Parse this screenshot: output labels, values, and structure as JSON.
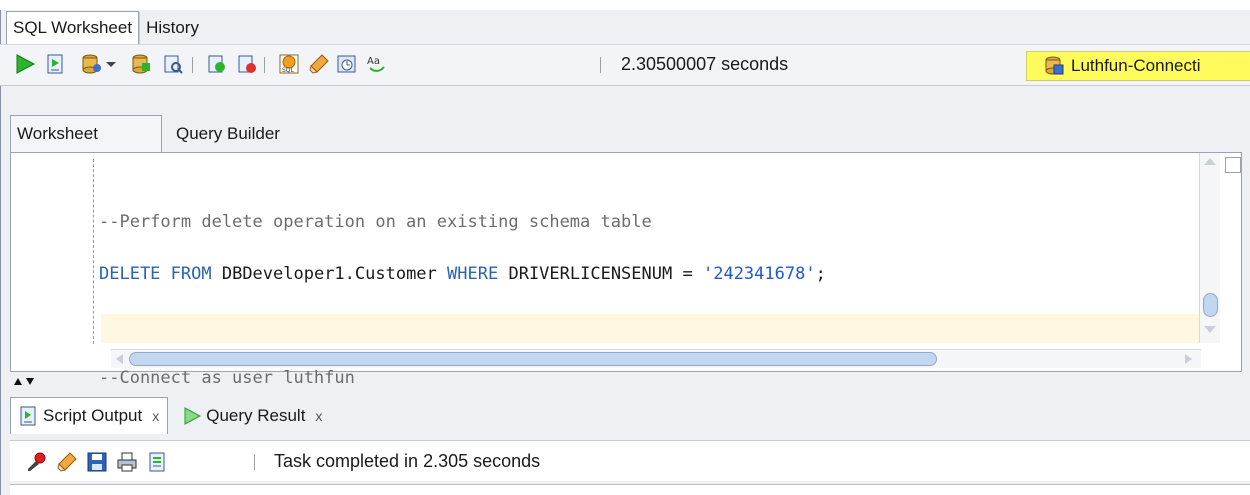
{
  "tabs": [
    {
      "label": "SQL Worksheet"
    },
    {
      "label": "History"
    }
  ],
  "toolbar": {
    "elapsed": "2.30500007 seconds",
    "connection": "Luthfun-Connecti",
    "icons": [
      "run-statement-icon",
      "run-script-icon",
      "commit-icon",
      "dropdown-icon",
      "rollback-icon",
      "autotrace-icon",
      "explain-plan-icon",
      "unshared-sql-icon",
      "sql-tuning-icon",
      "clear-icon",
      "sql-history-icon",
      "format-icon"
    ]
  },
  "editor_tabs": [
    {
      "label": "Worksheet"
    },
    {
      "label": "Query Builder"
    }
  ],
  "editor": {
    "line1": "--Perform delete operation on an existing schema table",
    "line2": {
      "kw1": "DELETE FROM",
      "target": "DBDeveloper1.Customer",
      "kw2": "WHERE",
      "column": "DRIVERLICENSENUM",
      "op": "=",
      "literal": "'242341678'",
      "end": ";"
    },
    "line3": "",
    "line4": "--Connect as user luthfun"
  },
  "bottom_tabs": [
    {
      "label": "Script Output",
      "close": "x"
    },
    {
      "label": "Query Result",
      "close": "x"
    }
  ],
  "bottom_toolbar": {
    "status": "Task completed in 2.305 seconds"
  },
  "colors": {
    "connection_highlight": "#fffb5c",
    "keyword": "#2a62b8",
    "string": "#1f57d8",
    "comment": "#6d6d6d"
  }
}
